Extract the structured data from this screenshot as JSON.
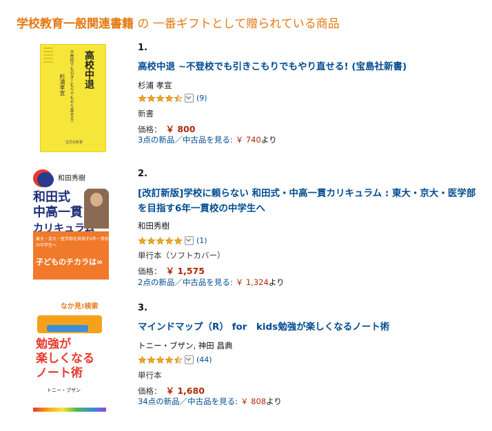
{
  "header": {
    "category": "学校教育一般関連書籍",
    "suffix": " の 一番ギフトとして贈られている商品"
  },
  "items": [
    {
      "rank": "1.",
      "title": "高校中退 ~不登校でも引きこもりでもやり直せる! (宝島社新書)",
      "author": "杉浦 孝宣",
      "rating": 4.5,
      "review_count": "(9)",
      "format": "新書",
      "price_label": "価格：",
      "price": "￥ 800",
      "offers_text": "3点の新品／中古品を見る:",
      "offers_price": "￥ 740",
      "offers_suffix": "より",
      "cover_title": "高校中退",
      "cover_subtitle": "不登校でも引きこもりでもやり直せる!",
      "cover_author": "杉浦孝宣",
      "cover_publisher": "宝島社新書"
    },
    {
      "rank": "2.",
      "title": "[改訂新版]学校に頼らない 和田式・中高一貫カリキュラム : 東大・京大・医学部を目指す6年一貫校の中学生へ",
      "author": "和田秀樹",
      "rating": 5,
      "review_count": "(1)",
      "format": "単行本（ソフトカバー）",
      "price_label": "価格：",
      "price": "￥ 1,575",
      "offers_text": "2点の新品／中古品を見る:",
      "offers_price": "￥ 1,324",
      "offers_suffix": "より",
      "cover_author": "和田秀樹",
      "cover_title_1": "和田式",
      "cover_title_2": "中高一貫",
      "cover_title_3": "カリキュラム",
      "cover_band": "東大・京大・医学部を目指す6年一貫校の中学生へ",
      "cover_catch": "子どものチカラは∞"
    },
    {
      "rank": "3.",
      "title": "マインドマップ（R） for　kids勉強が楽しくなるノート術",
      "author": "トニー・ブザン, 神田 昌典",
      "rating": 4.5,
      "review_count": "(44)",
      "format": "単行本",
      "price_label": "価格：",
      "price": "￥ 1,680",
      "offers_text": "34点の新品／中古品を見る:",
      "offers_price": "￥ 808",
      "offers_suffix": "より",
      "cover_top": "なか見!検索",
      "cover_title_1": "勉強が",
      "cover_title_2": "楽しくなる",
      "cover_title_3": "ノート術",
      "cover_author": "トニー・ブザン"
    }
  ],
  "colors": {
    "accent": "#e47911",
    "link": "#004b91",
    "price": "#b12704",
    "star": "#f4a41c"
  }
}
